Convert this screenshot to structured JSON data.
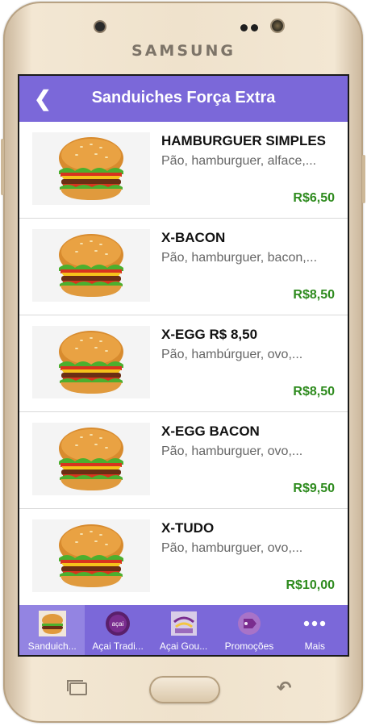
{
  "device": {
    "brand": "SAMSUNG"
  },
  "header": {
    "title": "Sanduiches Força Extra",
    "accent_color": "#7b68d9"
  },
  "items": [
    {
      "name": "HAMBURGUER SIMPLES",
      "description": "Pão, hamburguer, alface,...",
      "price": "R$6,50"
    },
    {
      "name": "X-BACON",
      "description": "Pão, hamburguer, bacon,...",
      "price": "R$8,50"
    },
    {
      "name": "X-EGG R$ 8,50",
      "description": "Pão, hambúrguer, ovo,...",
      "price": "R$8,50"
    },
    {
      "name": "X-EGG BACON",
      "description": "Pão, hamburguer, ovo,...",
      "price": "R$9,50"
    },
    {
      "name": "X-TUDO",
      "description": "Pão, hamburguer, ovo,...",
      "price": "R$10,00"
    }
  ],
  "bottom_nav": [
    {
      "label": "Sanduich...",
      "icon": "burger-icon",
      "active": true
    },
    {
      "label": "Açai Tradi...",
      "icon": "acai-icon",
      "active": false
    },
    {
      "label": "Açai Gou...",
      "icon": "acai-gourmet-icon",
      "active": false
    },
    {
      "label": "Promoções",
      "icon": "promo-tag-icon",
      "active": false
    },
    {
      "label": "Mais",
      "icon": "more-dots-icon",
      "active": false
    }
  ],
  "price_color": "#2e8b1e"
}
